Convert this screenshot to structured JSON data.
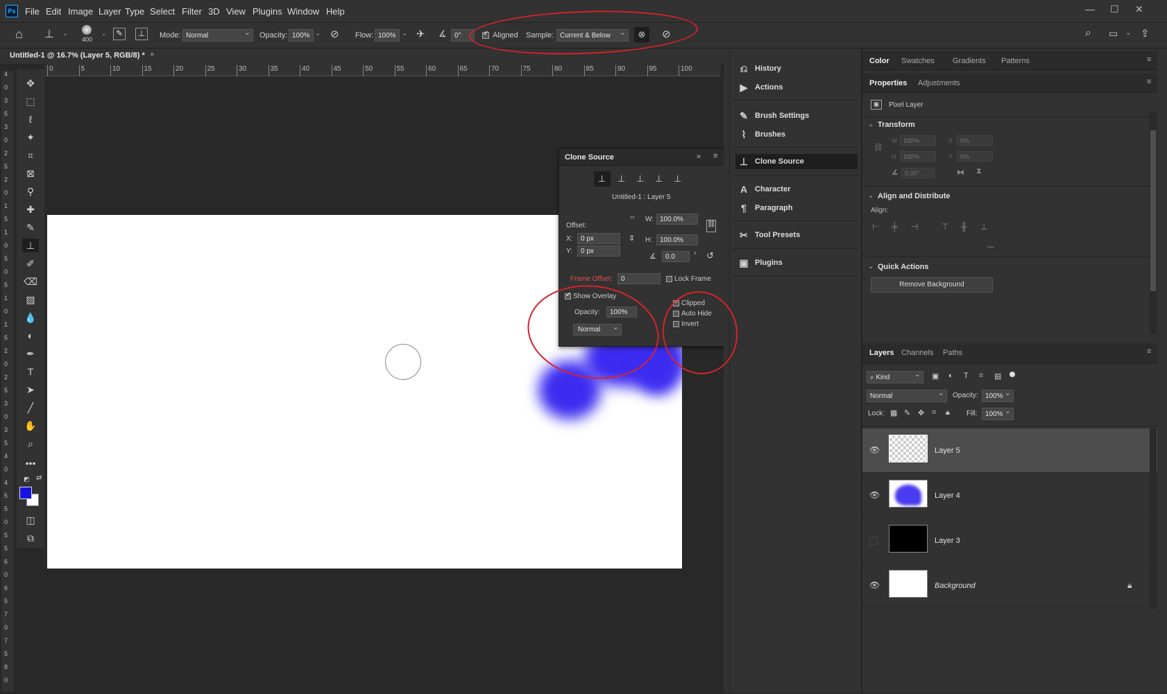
{
  "app": {
    "logo": "Ps"
  },
  "menu": [
    "File",
    "Edit",
    "Image",
    "Layer",
    "Type",
    "Select",
    "Filter",
    "3D",
    "View",
    "Plugins",
    "Window",
    "Help"
  ],
  "window_controls": [
    "—",
    "☐",
    "✕"
  ],
  "options": {
    "brush_size": "400",
    "mode_label": "Mode:",
    "mode_value": "Normal",
    "opacity_label": "Opacity:",
    "opacity_value": "100%",
    "flow_label": "Flow:",
    "flow_value": "100%",
    "angle_value": "0°",
    "aligned_label": "Aligned",
    "sample_label": "Sample:",
    "sample_value": "Current & Below"
  },
  "document_tab": {
    "title": "Untitled-1 @ 16.7% (Layer 5, RGB/8) *"
  },
  "ruler_h": [
    "0",
    "5",
    "10",
    "15",
    "20",
    "25",
    "30",
    "35",
    "40",
    "45",
    "50",
    "55",
    "60",
    "65",
    "70",
    "75",
    "80",
    "85",
    "90",
    "95",
    "100"
  ],
  "ruler_v": [
    "4",
    "0",
    "3",
    "5",
    "3",
    "0",
    "2",
    "5",
    "2",
    "0",
    "1",
    "5",
    "1",
    "0",
    "5",
    "0",
    "5",
    "1",
    "0",
    "1",
    "5",
    "2",
    "0",
    "2",
    "5",
    "3",
    "0",
    "3",
    "5",
    "4",
    "0",
    "4",
    "5",
    "5",
    "0",
    "5",
    "5",
    "6",
    "0",
    "6",
    "5",
    "7",
    "0",
    "7",
    "5",
    "8",
    "0"
  ],
  "clone_source": {
    "title": "Clone Source",
    "source_label": "Untitled-1 : Layer 5",
    "offset_label": "Offset:",
    "x_label": "X:",
    "x_value": "0 px",
    "y_label": "Y:",
    "y_value": "0 px",
    "w_label": "W:",
    "w_value": "100.0%",
    "h_label": "H:",
    "h_value": "100.0%",
    "angle_value": "0.0",
    "degree": "°",
    "frame_offset_label": "Frame Offset:",
    "frame_offset_value": "0",
    "lock_frame_label": "Lock Frame",
    "show_overlay_label": "Show Overlay",
    "overlay_opacity_label": "Opacity:",
    "overlay_opacity_value": "100%",
    "overlay_mode": "Normal",
    "clipped_label": "Clipped",
    "auto_hide_label": "Auto Hide",
    "invert_label": "Invert"
  },
  "mid_panel": {
    "items": [
      {
        "label": "History",
        "icon": "history-icon",
        "glyph": "⎌"
      },
      {
        "label": "Actions",
        "icon": "play-icon",
        "glyph": "▶"
      },
      {
        "label": "Brush Settings",
        "icon": "brush-settings-icon",
        "glyph": "✎"
      },
      {
        "label": "Brushes",
        "icon": "brushes-icon",
        "glyph": "⌇"
      },
      {
        "label": "Clone Source",
        "icon": "clone-stamp-icon",
        "glyph": "⊥"
      },
      {
        "label": "Character",
        "icon": "character-icon",
        "glyph": "A"
      },
      {
        "label": "Paragraph",
        "icon": "paragraph-icon",
        "glyph": "¶"
      },
      {
        "label": "Tool Presets",
        "icon": "tool-presets-icon",
        "glyph": "✂"
      },
      {
        "label": "Plugins",
        "icon": "plugins-icon",
        "glyph": "▣"
      }
    ]
  },
  "right_panel": {
    "top_tabs": [
      "Color",
      "Swatches",
      "Gradients",
      "Patterns"
    ],
    "prop_tabs": [
      "Properties",
      "Adjustments"
    ],
    "pixel_layer": "Pixel Layer",
    "transform": "Transform",
    "w_label": "W",
    "w_value": "100%",
    "x_label": "X",
    "x_value": "0%",
    "h_label": "H",
    "h_value": "100%",
    "y_label": "Y",
    "y_value": "0%",
    "angle_value": "0.00°",
    "align_distribute": "Align and Distribute",
    "align_label": "Align:",
    "more": "...",
    "quick_actions": "Quick Actions",
    "remove_bg": "Remove Background",
    "layer_tabs": [
      "Layers",
      "Channels",
      "Paths"
    ],
    "kind_label": "Kind",
    "blend_mode": "Normal",
    "opacity_label": "Opacity:",
    "opacity_value": "100%",
    "lock_label": "Lock:",
    "fill_label": "Fill:",
    "fill_value": "100%",
    "layers": [
      {
        "name": "Layer 5",
        "visible": true,
        "selected": true
      },
      {
        "name": "Layer 4",
        "visible": true,
        "selected": false
      },
      {
        "name": "Layer 3",
        "visible": false,
        "selected": false
      },
      {
        "name": "Background",
        "visible": true,
        "selected": false
      }
    ]
  },
  "colors": {
    "foreground": "#1a14e0",
    "background": "#ffffff",
    "paint": "#3c2cf0",
    "annotation": "#d6232a"
  }
}
